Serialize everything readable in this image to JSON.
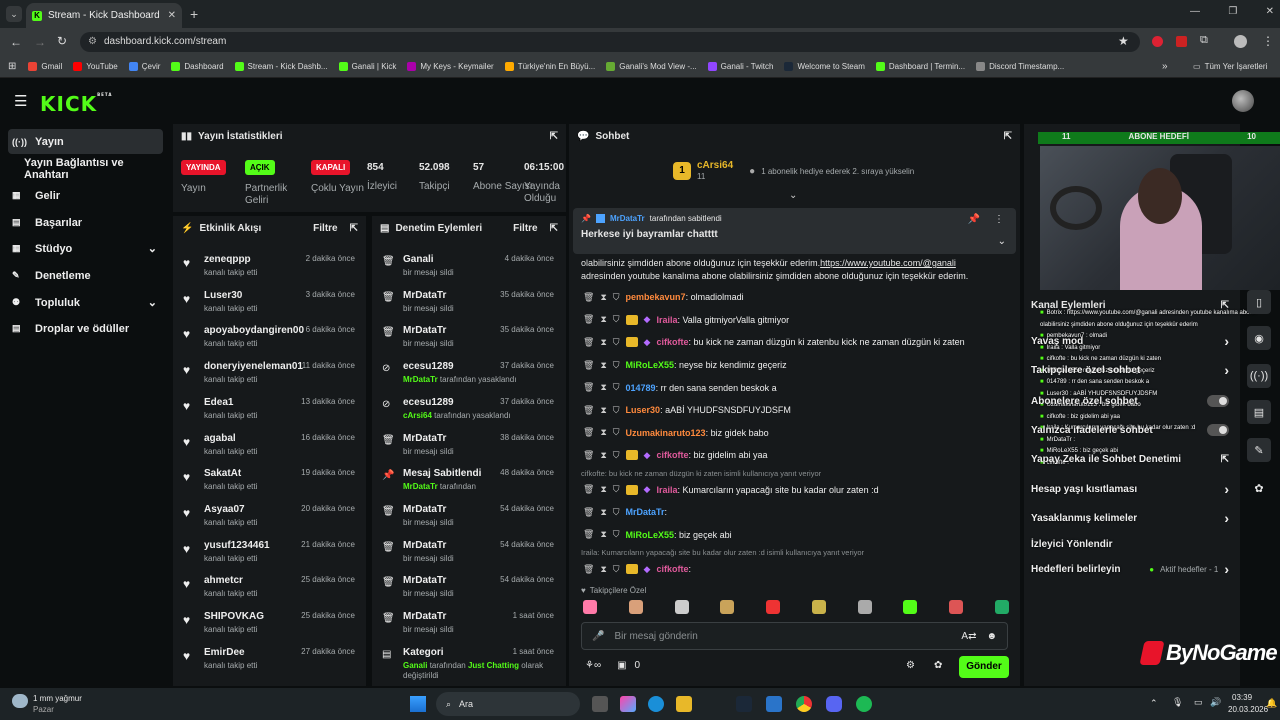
{
  "browser": {
    "tab_title": "Stream - Kick Dashboard",
    "url": "dashboard.kick.com/stream",
    "bookmarks": [
      "Gmail",
      "YouTube",
      "Çevir",
      "Dashboard",
      "Stream - Kick Dashb...",
      "Ganali | Kick",
      "My Keys - Keymailer",
      "Türkiye'nin En Büyü...",
      "Ganali's Mod View -...",
      "Ganali - Twitch",
      "Welcome to Steam",
      "Dashboard | Termin...",
      "Discord Timestamp..."
    ],
    "all_bookmarks": "Tüm Yer İşaretleri"
  },
  "logo": "KICK",
  "logo_sup": "BETA",
  "sidebar": [
    "Yayın",
    "Yayın Bağlantısı ve Anahtarı",
    "Gelir",
    "Başarılar",
    "Stüdyo",
    "Denetleme",
    "Topluluk",
    "Droplar ve ödüller"
  ],
  "stats": {
    "title": "Yayın İstatistikleri",
    "items": [
      {
        "value": "YAYINDA",
        "label": "Yayın",
        "color": "#e8142a"
      },
      {
        "value": "AÇIK",
        "label": "Partnerlik Geliri",
        "color": "#53fc18"
      },
      {
        "value": "KAPALI",
        "label": "Çoklu Yayın",
        "color": "#e8142a"
      },
      {
        "value": "854",
        "label": "İzleyici"
      },
      {
        "value": "52.098",
        "label": "Takipçi"
      },
      {
        "value": "57",
        "label": "Abone Sayısı"
      },
      {
        "value": "06:15:00",
        "label": "Yayında Olduğu"
      }
    ]
  },
  "activity": {
    "title": "Etkinlik Akışı",
    "filter": "Filtre",
    "events": [
      {
        "name": "zeneqppp",
        "sub": "kanalı takip etti",
        "time": "2 dakika önce"
      },
      {
        "name": "Luser30",
        "sub": "kanalı takip etti",
        "time": "3 dakika önce"
      },
      {
        "name": "apoyaboydangiren00",
        "sub": "kanalı takip etti",
        "time": "6 dakika önce"
      },
      {
        "name": "doneryiyeneleman01",
        "sub": "kanalı takip etti",
        "time": "11 dakika önce"
      },
      {
        "name": "Edea1",
        "sub": "kanalı takip etti",
        "time": "13 dakika önce"
      },
      {
        "name": "agabal",
        "sub": "kanalı takip etti",
        "time": "16 dakika önce"
      },
      {
        "name": "SakatAt",
        "sub": "kanalı takip etti",
        "time": "19 dakika önce"
      },
      {
        "name": "Asyaa07",
        "sub": "kanalı takip etti",
        "time": "20 dakika önce"
      },
      {
        "name": "yusuf1234461",
        "sub": "kanalı takip etti",
        "time": "21 dakika önce"
      },
      {
        "name": "ahmetcr",
        "sub": "kanalı takip etti",
        "time": "25 dakika önce"
      },
      {
        "name": "SHIPOVKAG",
        "sub": "kanalı takip etti",
        "time": "25 dakika önce"
      },
      {
        "name": "EmirDee",
        "sub": "kanalı takip etti",
        "time": "27 dakika önce"
      }
    ]
  },
  "moderation": {
    "title": "Denetim Eylemleri",
    "filter": "Filtre",
    "events": [
      {
        "name": "Ganali",
        "sub": "bir mesajı sildi",
        "time": "4 dakika önce",
        "icon": "trash-icon"
      },
      {
        "name": "MrDataTr",
        "sub": "bir mesajı sildi",
        "time": "35 dakika önce",
        "icon": "trash-icon"
      },
      {
        "name": "MrDataTr",
        "sub": "bir mesajı sildi",
        "time": "35 dakika önce",
        "icon": "trash-icon"
      },
      {
        "name": "ecesu1289",
        "sub": "MrDataTr",
        "sub2": "tarafından yasaklandı",
        "time": "37 dakika önce",
        "icon": "ban-icon"
      },
      {
        "name": "ecesu1289",
        "sub": "cArsi64",
        "sub2": "tarafından yasaklandı",
        "time": "37 dakika önce",
        "icon": "ban-icon"
      },
      {
        "name": "MrDataTr",
        "sub": "bir mesajı sildi",
        "time": "38 dakika önce",
        "icon": "trash-icon"
      },
      {
        "name": "Mesaj Sabitlendi",
        "sub": "MrDataTr",
        "sub2": "tarafından",
        "time": "48 dakika önce",
        "icon": "pin-icon"
      },
      {
        "name": "MrDataTr",
        "sub": "bir mesajı sildi",
        "time": "54 dakika önce",
        "icon": "trash-icon"
      },
      {
        "name": "MrDataTr",
        "sub": "bir mesajı sildi",
        "time": "54 dakika önce",
        "icon": "trash-icon"
      },
      {
        "name": "MrDataTr",
        "sub": "bir mesajı sildi",
        "time": "54 dakika önce",
        "icon": "trash-icon"
      },
      {
        "name": "MrDataTr",
        "sub": "bir mesajı sildi",
        "time": "1 saat önce",
        "icon": "trash-icon"
      },
      {
        "name": "Kategori",
        "sub": "Ganali",
        "sub2": "tarafından",
        "sub3": "Just Chatting",
        "sub4": "olarak değiştirildi",
        "time": "1 saat önce",
        "icon": "category-icon"
      }
    ]
  },
  "chat": {
    "title": "Sohbet",
    "gift": {
      "rank": "1",
      "user": "cArsi64",
      "count": "11",
      "text": "1 abonelik hediye ederek 2. sıraya yükselin"
    },
    "pinned": {
      "by": "MrDataTr",
      "by_suffix": "tarafından sabitlendi",
      "text": "Herkese iyi bayramlar chatttt"
    },
    "youtube_line1": "olabilirsiniz şimdiden abone olduğunuz için teşekkür ederim.",
    "youtube_link": "https://www.youtube.com/@ganali",
    "youtube_line2": "adresinden youtube kanalıma abone olabilirsiniz şimdiden abone olduğunuz için teşekkür ederim.",
    "messages": [
      {
        "user": "pembekavun7",
        "color": "#ff8a3d",
        "text": ": olmadiolmadi",
        "crown": false
      },
      {
        "user": "Iraila",
        "color": "#e05a9c",
        "text": ": Valla gitmiyorValla gitmiyor",
        "crown": true
      },
      {
        "user": "cifkofte",
        "color": "#e05a9c",
        "text": ": bu kick ne zaman düzgün ki zatenbu kick ne zaman düzgün ki zaten",
        "crown": true
      },
      {
        "user": "MiRoLeX55",
        "color": "#53fc18",
        "text": ": neyse biz kendimiz geçeriz",
        "crown": false
      },
      {
        "user": "014789",
        "color": "#4da3ff",
        "text": ": rr den sana senden beskok a",
        "crown": false
      },
      {
        "user": "Luser30",
        "color": "#ff8a3d",
        "text": ": aABİ YHUDFSNSDFUYJDSFM",
        "crown": false
      },
      {
        "user": "Uzumakinaruto123",
        "color": "#ff8a3d",
        "text": ": biz gidek babo",
        "crown": false
      },
      {
        "user": "cifkofte",
        "color": "#e05a9c",
        "text": ": biz gidelim abi yaa",
        "crown": true
      },
      {
        "user": "Iraila",
        "color": "#e05a9c",
        "text": ": Kumarcıların yapacağı site bu kadar olur zaten :d",
        "crown": true,
        "reply": "cifkofte: bu kick ne zaman düzgün ki zaten isimli kullanıcıya yanıt veriyor"
      },
      {
        "user": "MrDataTr",
        "color": "#4da3ff",
        "text": ":",
        "crown": false
      },
      {
        "user": "MiRoLeX55",
        "color": "#53fc18",
        "text": ": biz geçek abi",
        "crown": false
      },
      {
        "user": "cifkofte",
        "color": "#e05a9c",
        "text": ":",
        "crown": true,
        "reply": "Iraila: Kumarcıların yapacağı site bu kadar olur zaten :d isimli kullanıcıya yanıt veriyor"
      }
    ],
    "follower_only": "Takipçilere Özel",
    "input_placeholder": "Bir mesaj gönderin",
    "points": "0",
    "send": "Gönder"
  },
  "stream_overlay": {
    "goal_left": "11",
    "goal_title": "ABONE HEDEFİ",
    "goal_right": "10",
    "watermark": "ByNoGame"
  },
  "channel_actions": {
    "title": "Kanal Eylemleri",
    "items": [
      {
        "label": "Yavaş mod",
        "kind": "arrow"
      },
      {
        "label": "Takipçilere özel sohbet",
        "kind": "arrow"
      },
      {
        "label": "Abonelere özel sohbet",
        "kind": "toggle"
      },
      {
        "label": "Yalnızca ifadelerle sohbet",
        "kind": "toggle"
      },
      {
        "label": "Yapay Zeka ile Sohbet Denetimi",
        "kind": "ext"
      },
      {
        "label": "Hesap yaşı kısıtlaması",
        "kind": "arrow"
      },
      {
        "label": "Yasaklanmış kelimeler",
        "kind": "arrow"
      },
      {
        "label": "İzleyici Yönlendir",
        "kind": "none"
      },
      {
        "label": "Hedefleri belirleyin",
        "kind": "arrow",
        "extra": "Aktif hedefler - 1"
      }
    ]
  },
  "overlay_chat": [
    "Botrix : https://www.youtube.com/@ganali adresinden youtube kanalıma abone olabilirsiniz şimdiden abone olduğunuz için teşekkür ederim",
    "pembekavun7 : olmadi",
    "Iraila : Valla gitmiyor",
    "cifkofte : bu kick ne zaman düzgün ki zaten",
    "MiRoLeX55 : neyse biz kendimiz geçeriz",
    "014789 : rr den sana senden beskok a",
    "Luser30 : aABİ YHUDFSNSDFUYJDSFM",
    "Uzumakinaruto123 : biz gidek babo",
    "cifkofte : biz gidelim abi yaa",
    "Iraila : Kumarcıların yapacağı site bu kadar olur zaten :d",
    "MrDataTr : ",
    "MiRoLeX55 : biz geçek abi",
    "cifkofte : "
  ],
  "taskbar": {
    "weather": "1 mm yağmur",
    "weather_sub": "Pazar",
    "search": "Ara",
    "time": "03:39",
    "date": "20.03.2026"
  }
}
